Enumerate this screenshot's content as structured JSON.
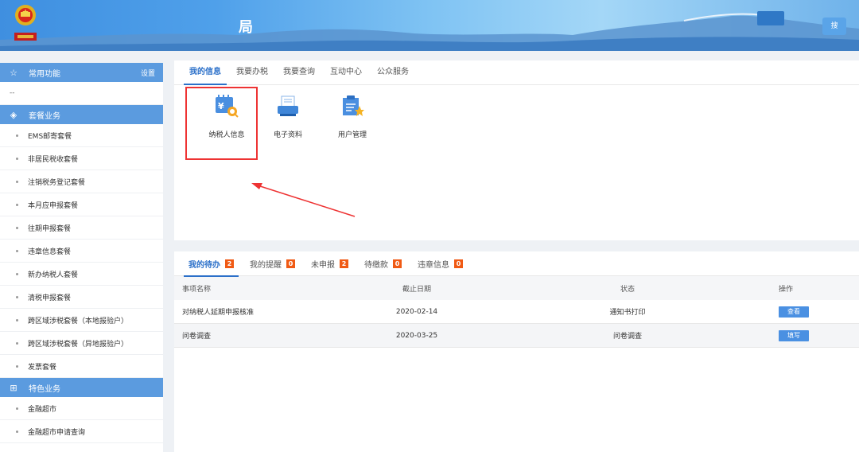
{
  "header": {
    "title": "局",
    "button_label": "搜"
  },
  "sidebar": {
    "sections": [
      {
        "icon": "star-icon",
        "label": "常用功能",
        "right": "设置"
      },
      {
        "icon": "layers-icon",
        "label": "套餐业务"
      },
      {
        "icon": "grid-icon",
        "label": "特色业务"
      }
    ],
    "common_empty": "--",
    "package_items": [
      "EMS邮寄套餐",
      "非居民税收套餐",
      "注销税务登记套餐",
      "本月应申报套餐",
      "往期申报套餐",
      "违章信息套餐",
      "新办纳税人套餐",
      "清税申报套餐",
      "跨区域涉税套餐（本地报验户）",
      "跨区域涉税套餐（异地报验户）",
      "发票套餐"
    ],
    "special_items": [
      "金融超市",
      "金融超市申请查询"
    ]
  },
  "top_tabs": [
    "我的信息",
    "我要办税",
    "我要查询",
    "互动中心",
    "公众服务"
  ],
  "apps": [
    {
      "label": "纳税人信息",
      "icon": "taxpayer-info-icon"
    },
    {
      "label": "电子资料",
      "icon": "electronic-docs-icon"
    },
    {
      "label": "用户管理",
      "icon": "user-management-icon"
    }
  ],
  "bottom_tabs": [
    {
      "label": "我的待办",
      "count": "2"
    },
    {
      "label": "我的提醒",
      "count": "0"
    },
    {
      "label": "未申报",
      "count": "2"
    },
    {
      "label": "待缴款",
      "count": "0"
    },
    {
      "label": "违章信息",
      "count": "0"
    }
  ],
  "table": {
    "headers": [
      "事项名称",
      "截止日期",
      "状态",
      "操作"
    ],
    "rows": [
      {
        "name": "对纳税人延期申报核准",
        "deadline": "2020-02-14",
        "status": "通知书打印",
        "action": "查看"
      },
      {
        "name": "问卷调查",
        "deadline": "2020-03-25",
        "status": "问卷调查",
        "action": "填写"
      }
    ]
  },
  "colors": {
    "accent": "#2b70c9",
    "sidebar_section": "#5b9bdf",
    "badge": "#f05a14",
    "highlight": "#e33333"
  }
}
